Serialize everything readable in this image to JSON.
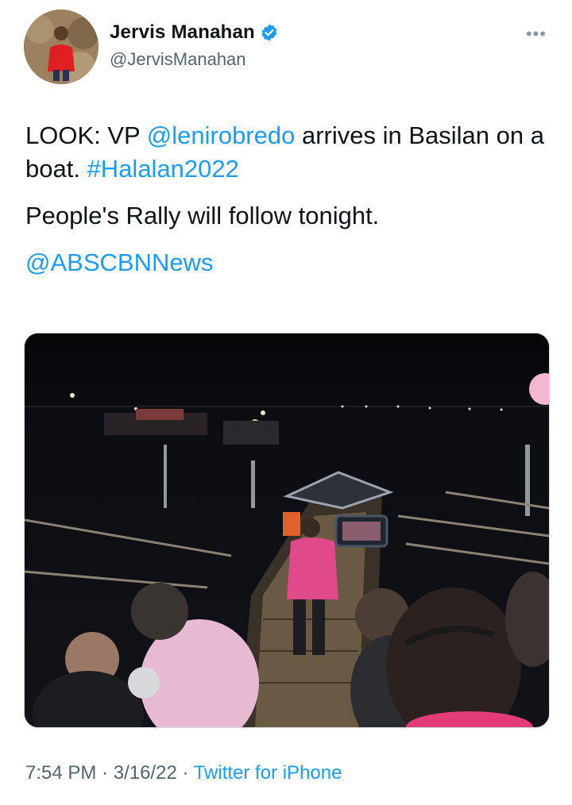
{
  "author": {
    "name": "Jervis Manahan",
    "handle": "@JervisManahan",
    "verified_icon": "verified-badge-icon",
    "more_icon": "more-options-icon"
  },
  "tweet": {
    "line1_prefix": "LOOK: VP ",
    "mention1": "@lenirobredo",
    "line1_suffix": " arrives in Basilan on a boat. ",
    "hashtag": "#Halalan2022",
    "line2": "People's Rally will follow tonight.",
    "mention2": "@ABSCBNNews"
  },
  "meta": {
    "time": "7:54 PM",
    "sep1": " · ",
    "date": "3/16/22",
    "sep2": " · ",
    "source": "Twitter for iPhone"
  },
  "colors": {
    "link": "#1d9bf0",
    "secondary_text": "#536471",
    "verified": "#1d9bf0"
  }
}
